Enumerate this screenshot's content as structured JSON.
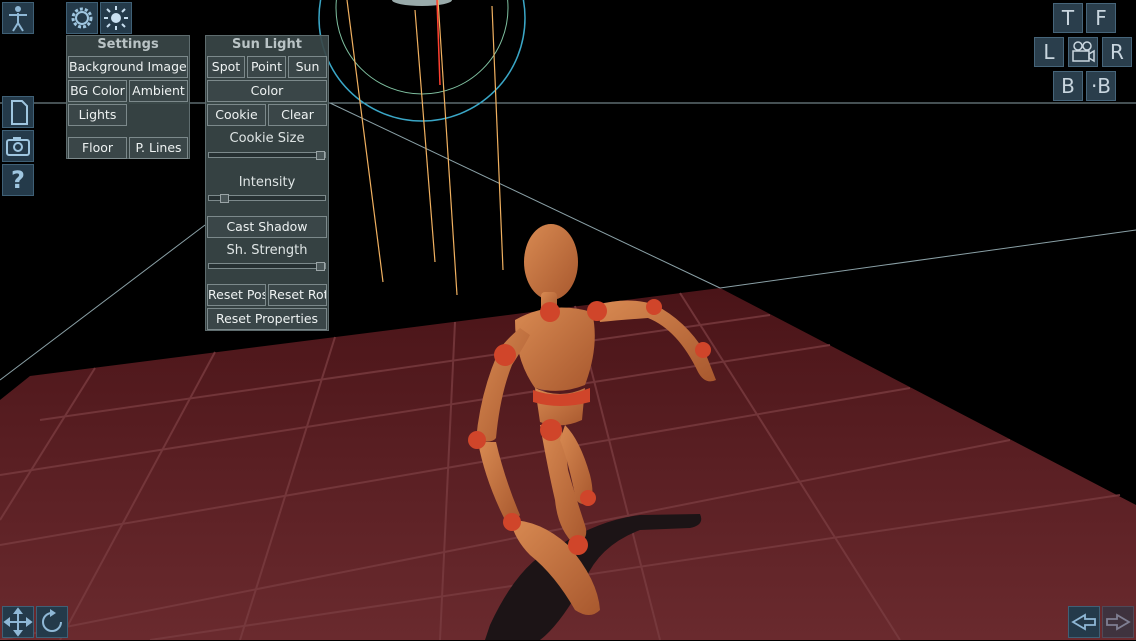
{
  "settings_panel": {
    "title": "Settings",
    "background_images": "Background Images",
    "bg_color": "BG Color",
    "ambient": "Ambient",
    "lights": "Lights",
    "floor": "Floor",
    "p_lines": "P. Lines"
  },
  "sun_panel": {
    "title": "Sun Light",
    "spot": "Spot",
    "point": "Point",
    "sun": "Sun",
    "color": "Color",
    "cookie": "Cookie",
    "clear": "Clear",
    "cookie_size": "Cookie Size",
    "cookie_size_value": 1.0,
    "intensity": "Intensity",
    "intensity_value": 0.1,
    "cast_shadow": "Cast Shadow",
    "sh_strength": "Sh. Strength",
    "sh_strength_value": 1.0,
    "reset_pos": "Reset Pos",
    "reset_rot": "Reset Rot",
    "reset_properties": "Reset Properties"
  },
  "view_buttons": {
    "top": "T",
    "front": "F",
    "left": "L",
    "right": "R",
    "back": "B",
    "back2": "·B"
  },
  "colors": {
    "panel_bg": "#3a4648",
    "floor": "#5a1e22",
    "mannequin": "#c86a3a",
    "accent_icon": "#8fb8d6"
  }
}
